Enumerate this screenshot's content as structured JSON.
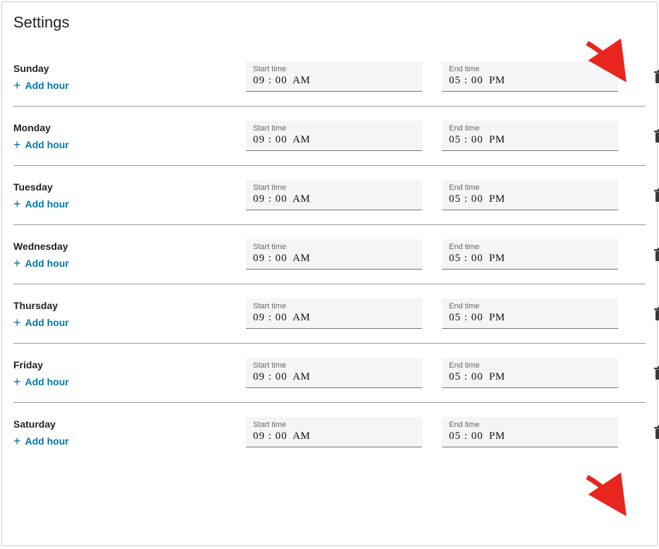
{
  "title": "Settings",
  "labels": {
    "add_hour": "Add hour",
    "start_time": "Start time",
    "end_time": "End time"
  },
  "days": [
    {
      "name": "Sunday",
      "start": "09 : 00",
      "start_ampm": "AM",
      "end": "05 : 00",
      "end_ampm": "PM",
      "annotation_arrow": true
    },
    {
      "name": "Monday",
      "start": "09 : 00",
      "start_ampm": "AM",
      "end": "05 : 00",
      "end_ampm": "PM",
      "annotation_arrow": false
    },
    {
      "name": "Tuesday",
      "start": "09 : 00",
      "start_ampm": "AM",
      "end": "05 : 00",
      "end_ampm": "PM",
      "annotation_arrow": false
    },
    {
      "name": "Wednesday",
      "start": "09 : 00",
      "start_ampm": "AM",
      "end": "05 : 00",
      "end_ampm": "PM",
      "annotation_arrow": false
    },
    {
      "name": "Thursday",
      "start": "09 : 00",
      "start_ampm": "AM",
      "end": "05 : 00",
      "end_ampm": "PM",
      "annotation_arrow": false
    },
    {
      "name": "Friday",
      "start": "09 : 00",
      "start_ampm": "AM",
      "end": "05 : 00",
      "end_ampm": "PM",
      "annotation_arrow": false
    },
    {
      "name": "Saturday",
      "start": "09 : 00",
      "start_ampm": "AM",
      "end": "05 : 00",
      "end_ampm": "PM",
      "annotation_arrow": true
    }
  ]
}
